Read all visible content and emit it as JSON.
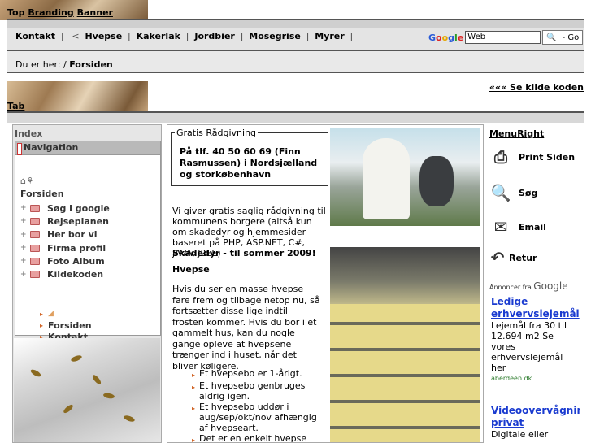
{
  "banner": {
    "word1": "Top",
    "word2": "Branding",
    "word3": "Banner"
  },
  "nav": {
    "links": [
      "Kontakt",
      "Hvepse",
      "Kakerlak",
      "Jordbier",
      "Mosegrise",
      "Myrer"
    ],
    "separator": "|",
    "back_glyph": "<",
    "google": {
      "g1": "G",
      "g2": "o",
      "g3": "o",
      "g4": "g",
      "g5": "l",
      "g6": "e",
      "search_value": "Web",
      "button_label": "- Go"
    }
  },
  "breadcrumb": {
    "prefix": "Du er her: /",
    "current": "Forsiden"
  },
  "tab": {
    "label": "Tab",
    "source_link": "««« Se kilde koden"
  },
  "left": {
    "index_label": "Index",
    "nav_header": "Navigation",
    "tree_icon_text": "⌂⚘",
    "forsiden": "Forsiden",
    "tree": [
      "Søg i google",
      "Rejseplanen",
      "Her bor vi",
      "Firma profil",
      "Foto Album",
      "Kildekoden"
    ],
    "sub": [
      "Forsiden",
      "Kontakt"
    ]
  },
  "main": {
    "advice_legend": "Gratis Rådgivning",
    "advice_text": "På tlf. 40 50 60 69 (Finn Rasmussen) i Nordsjælland og storkøbenhavn",
    "p1": "Vi giver gratis saglig rådgivning til kommunens borgere (altså kun om skadedyr og hjemmesider baseret på PHP, ASP.NET, C#, JAVA, J2EE)",
    "skadedyr": "Skadedyr - til sommer 2009!",
    "hvepse": "Hvepse",
    "p2": "Hvis du ser en masse hvepse fare frem og tilbage netop nu, så fortsætter disse lige indtil frosten kommer. Hvis du bor i et gammelt hus, kan du nogle gange opleve at hvepsene trænger ind i huset, når det bliver køligere.",
    "bullets": [
      "Et hvepsebo er 1-årigt.",
      "Et hvepsebo genbruges aldrig igen.",
      "Et hvepsebo uddør i aug/sep/okt/nov afhængig af hvepseart.",
      "Det er en enkelt hvepse"
    ]
  },
  "right": {
    "menu_label": "MenuRight",
    "items": [
      "Print Siden",
      "Søg",
      "Email",
      "Retur"
    ],
    "ads_label_small": "Annoncer fra",
    "ads_label_big": "Google",
    "ad1": {
      "title": "Ledige erhvervslejemål",
      "body": "Lejemål fra 30 til 12.694 m2 Se vores erhvervslejemål her",
      "url": "aberdeen.dk"
    },
    "ad2": {
      "title": "Videoovervågning privat",
      "body": "Digitale eller"
    }
  }
}
